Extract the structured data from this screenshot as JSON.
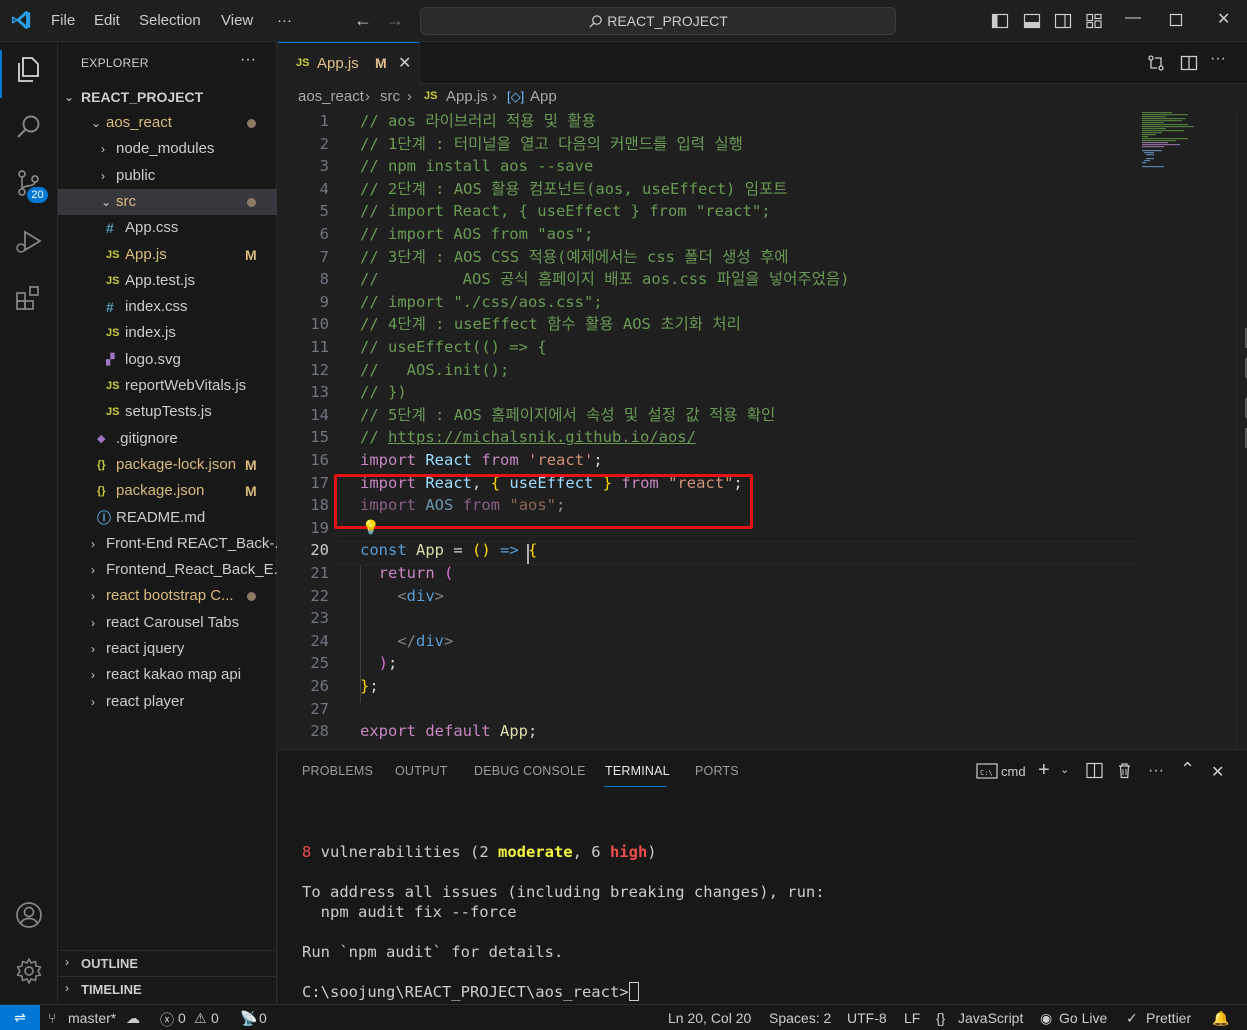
{
  "menu": [
    "File",
    "Edit",
    "Selection",
    "View"
  ],
  "menu_more": "···",
  "search": {
    "label": "REACT_PROJECT"
  },
  "explorer": {
    "title": "EXPLORER",
    "more": "···",
    "root": "REACT_PROJECT",
    "tree": [
      {
        "label": "aos_react",
        "chev": "⌄",
        "indent": 1,
        "color": "gold",
        "dot": true
      },
      {
        "label": "node_modules",
        "chev": "›",
        "indent": 2
      },
      {
        "label": "public",
        "chev": "›",
        "indent": 2
      },
      {
        "label": "src",
        "chev": "⌄",
        "indent": 2,
        "color": "gold",
        "dot": true,
        "selected": true
      },
      {
        "label": "App.css",
        "icon": "#",
        "icontype": "css-ic",
        "indent": 3
      },
      {
        "label": "App.js",
        "icon": "JS",
        "icontype": "js-ic",
        "indent": 3,
        "color": "gold",
        "mod": "M"
      },
      {
        "label": "App.test.js",
        "icon": "JS",
        "icontype": "js-ic",
        "indent": 3
      },
      {
        "label": "index.css",
        "icon": "#",
        "icontype": "css-ic",
        "indent": 3
      },
      {
        "label": "index.js",
        "icon": "JS",
        "icontype": "js-ic",
        "indent": 3
      },
      {
        "label": "logo.svg",
        "icon": "▞",
        "icontype": "svg-ic",
        "indent": 3
      },
      {
        "label": "reportWebVitals.js",
        "icon": "JS",
        "icontype": "js-ic",
        "indent": 3
      },
      {
        "label": "setupTests.js",
        "icon": "JS",
        "icontype": "js-ic",
        "indent": 3
      },
      {
        "label": ".gitignore",
        "icon": "◆",
        "icontype": "svg-ic",
        "indent": 2
      },
      {
        "label": "package-lock.json",
        "icon": "{}",
        "icontype": "json-ic",
        "indent": 2,
        "color": "gold",
        "mod": "M"
      },
      {
        "label": "package.json",
        "icon": "{}",
        "icontype": "json-ic",
        "indent": 2,
        "color": "gold",
        "mod": "M"
      },
      {
        "label": "README.md",
        "icon": "ⓘ",
        "icontype": "css-ic",
        "indent": 2
      },
      {
        "label": "Front-End REACT_Back-...",
        "chev": "›",
        "indent": 1
      },
      {
        "label": "Frontend_React_Back_E...",
        "chev": "›",
        "indent": 1
      },
      {
        "label": "react bootstrap C...",
        "chev": "›",
        "indent": 1,
        "color": "gold",
        "dot": true
      },
      {
        "label": "react Carousel Tabs",
        "chev": "›",
        "indent": 1
      },
      {
        "label": "react jquery",
        "chev": "›",
        "indent": 1
      },
      {
        "label": "react kakao map api",
        "chev": "›",
        "indent": 1
      },
      {
        "label": "react player",
        "chev": "›",
        "indent": 1
      }
    ],
    "outline": "OUTLINE",
    "timeline": "TIMELINE"
  },
  "scm_badge": "20",
  "tab": {
    "icon": "JS",
    "label": "App.js",
    "mod": "M",
    "close": "✕"
  },
  "breadcrumb": {
    "p1": "aos_react",
    "p2": "src",
    "p3_icon": "JS",
    "p3": "App.js",
    "p4": "App"
  },
  "code": {
    "current_line": 20,
    "lines": [
      [
        [
          "cm",
          "// aos 라이브러리 적용 및 활용"
        ]
      ],
      [
        [
          "cm",
          "// 1단계 : 터미널을 열고 다음의 커맨드를 입력 실행"
        ]
      ],
      [
        [
          "cm",
          "// npm install aos --save"
        ]
      ],
      [
        [
          "cm",
          "// 2단계 : AOS 활용 컴포넌트(aos, useEffect) 임포트"
        ]
      ],
      [
        [
          "cm",
          "// import React, { useEffect } from \"react\";"
        ]
      ],
      [
        [
          "cm",
          "// import AOS from \"aos\";"
        ]
      ],
      [
        [
          "cm",
          "// 3단계 : AOS CSS 적용(예제에서는 css 폴더 생성 후에"
        ]
      ],
      [
        [
          "cm",
          "//         AOS 공식 홈페이지 배포 aos.css 파일을 넣어주었음)"
        ]
      ],
      [
        [
          "cm",
          "// import \"./css/aos.css\";"
        ]
      ],
      [
        [
          "cm",
          "// 4단계 : useEffect 함수 활용 AOS 초기화 처리"
        ]
      ],
      [
        [
          "cm",
          "// useEffect(() => {"
        ]
      ],
      [
        [
          "cm",
          "//   AOS.init();"
        ]
      ],
      [
        [
          "cm",
          "// })"
        ]
      ],
      [
        [
          "cm",
          "// 5단계 : AOS 홈페이지에서 속성 및 설정 값 적용 확인"
        ]
      ],
      [
        [
          "cm",
          "// "
        ],
        [
          "cm-link",
          "https://michalsnik.github.io/aos/"
        ]
      ],
      [
        [
          "kw",
          "import"
        ],
        [
          "pn",
          " "
        ],
        [
          "var",
          "React"
        ],
        [
          "pn",
          " "
        ],
        [
          "kw",
          "from"
        ],
        [
          "pn",
          " "
        ],
        [
          "str",
          "'react'"
        ],
        [
          "pn",
          ";"
        ]
      ],
      [
        [
          "kw",
          "import"
        ],
        [
          "pn",
          " "
        ],
        [
          "var",
          "React"
        ],
        [
          "pn",
          ", "
        ],
        [
          "brk",
          "{"
        ],
        [
          "pn",
          " "
        ],
        [
          "var",
          "useEffect"
        ],
        [
          "pn",
          " "
        ],
        [
          "brk",
          "}"
        ],
        [
          "pn",
          " "
        ],
        [
          "kw",
          "from"
        ],
        [
          "pn",
          " "
        ],
        [
          "str",
          "\"react\""
        ],
        [
          "pn",
          ";"
        ]
      ],
      [
        [
          "kw dim",
          "import"
        ],
        [
          "pn dim",
          " "
        ],
        [
          "var dim",
          "AOS"
        ],
        [
          "pn dim",
          " "
        ],
        [
          "kw dim",
          "from"
        ],
        [
          "pn dim",
          " "
        ],
        [
          "str dim",
          "\"aos\""
        ],
        [
          "pn dim",
          ";"
        ]
      ],
      [],
      [
        [
          "kw2",
          "const"
        ],
        [
          "pn",
          " "
        ],
        [
          "fn",
          "App"
        ],
        [
          "pn",
          " = "
        ],
        [
          "brk",
          "()"
        ],
        [
          "pn",
          " "
        ],
        [
          "kw2",
          "=>"
        ],
        [
          "pn",
          " "
        ],
        [
          "brk",
          "{"
        ]
      ],
      [
        [
          "pn",
          "  "
        ],
        [
          "kw",
          "return"
        ],
        [
          "pn",
          " "
        ],
        [
          "brk2",
          "("
        ]
      ],
      [
        [
          "pn",
          "    "
        ],
        [
          "tag",
          "<"
        ],
        [
          "tagn",
          "div"
        ],
        [
          "tag",
          ">"
        ]
      ],
      [],
      [
        [
          "pn",
          "    "
        ],
        [
          "tag",
          "</"
        ],
        [
          "tagn",
          "div"
        ],
        [
          "tag",
          ">"
        ]
      ],
      [
        [
          "pn",
          "  "
        ],
        [
          "brk2",
          ")"
        ],
        [
          "pn",
          ";"
        ]
      ],
      [
        [
          "brk",
          "}"
        ],
        [
          "pn",
          ";"
        ]
      ],
      [],
      [
        [
          "kw",
          "export"
        ],
        [
          "pn",
          " "
        ],
        [
          "kw",
          "default"
        ],
        [
          "pn",
          " "
        ],
        [
          "fn",
          "App"
        ],
        [
          "pn",
          ";"
        ]
      ]
    ]
  },
  "panel": {
    "tabs": [
      "PROBLEMS",
      "OUTPUT",
      "DEBUG CONSOLE",
      "TERMINAL",
      "PORTS"
    ],
    "active_tab": "TERMINAL",
    "shell": "cmd",
    "terminal": {
      "vuln_count": "8",
      "vuln_text": " vulnerabilities (2 ",
      "moderate": "moderate",
      "mid": ", 6 ",
      "high": "high",
      "end": ")",
      "line2": "To address all issues (including breaking changes), run:",
      "line3": "  npm audit fix --force",
      "line4": "Run `npm audit` for details.",
      "prompt": "C:\\soojung\\REACT_PROJECT\\aos_react>"
    }
  },
  "status": {
    "branch": "master*",
    "errors": "0",
    "warnings": "0",
    "ports": "0",
    "position": "Ln 20, Col 20",
    "spaces": "Spaces: 2",
    "encoding": "UTF-8",
    "eol": "LF",
    "language": "JavaScript",
    "golive": "Go Live",
    "prettier": "Prettier"
  },
  "colors": {
    "accent": "#0078d4",
    "highlight_box": "#e51414",
    "modified": "#e2c08d"
  }
}
